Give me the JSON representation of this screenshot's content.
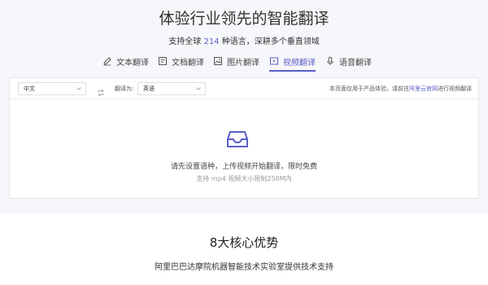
{
  "header": {
    "title": "体验行业领先的智能翻译",
    "subtitle_prefix": "支持全球",
    "subtitle_count": "214",
    "subtitle_suffix": "种语言，深耕多个垂直领域"
  },
  "tabs": [
    {
      "label": "文本翻译",
      "icon": "pen-icon",
      "active": false
    },
    {
      "label": "文档翻译",
      "icon": "document-icon",
      "active": false
    },
    {
      "label": "图片翻译",
      "icon": "image-icon",
      "active": false
    },
    {
      "label": "视频翻译",
      "icon": "video-icon",
      "active": true
    },
    {
      "label": "语音翻译",
      "icon": "microphone-icon",
      "active": false
    }
  ],
  "translator": {
    "source_lang": "中文",
    "target_label": "翻译为:",
    "target_lang": "英语",
    "note_prefix": "本页面仅用于产品体验，请前往",
    "note_link": "阿里云官网",
    "note_suffix": "进行视频翻译"
  },
  "empty_state": {
    "icon": "inbox-icon",
    "message": "请先设置语种，上传视频开始翻译，限时免费",
    "hint": "支持 mp4 视频大小限制250M内"
  },
  "section": {
    "title": "8大核心优势",
    "subtitle": "阿里巴巴达摩院机器智能技术实验室提供技术支持"
  },
  "colors": {
    "accent": "#5b5fc7",
    "page_bg": "#f6f7fa"
  }
}
